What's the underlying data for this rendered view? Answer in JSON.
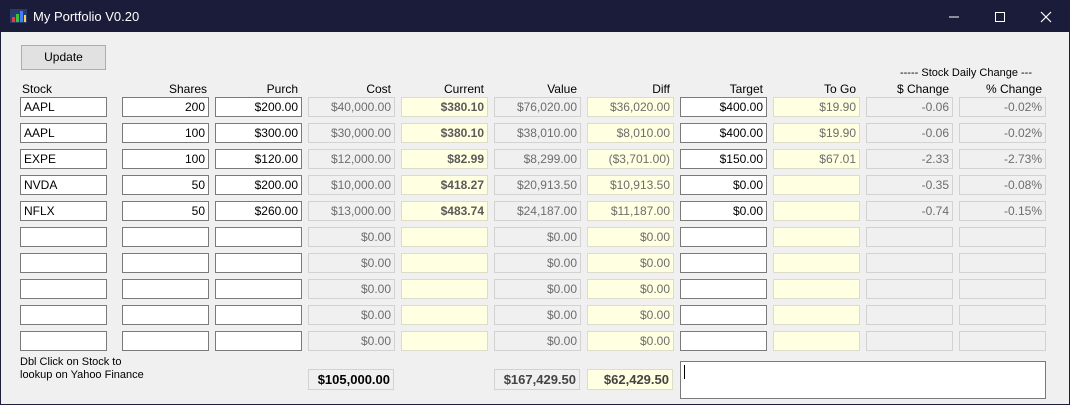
{
  "window": {
    "title": "My Portfolio V0.20",
    "icon": "chart-app-icon"
  },
  "toolbar": {
    "update_label": "Update"
  },
  "headers": {
    "stock": "Stock",
    "shares": "Shares",
    "purch": "Purch",
    "cost": "Cost",
    "current": "Current",
    "value": "Value",
    "diff": "Diff",
    "target": "Target",
    "to_go": "To Go",
    "daily_group": "----- Stock  Daily Change ---",
    "dollar_change": "$ Change",
    "pct_change": "% Change"
  },
  "rows": [
    {
      "stock": "AAPL",
      "shares": "200",
      "purch": "$200.00",
      "cost": "$40,000.00",
      "current": "$380.10",
      "value": "$76,020.00",
      "diff": "$36,020.00",
      "target": "$400.00",
      "to_go": "$19.90",
      "dchg": "-0.06",
      "pchg": "-0.02%"
    },
    {
      "stock": "AAPL",
      "shares": "100",
      "purch": "$300.00",
      "cost": "$30,000.00",
      "current": "$380.10",
      "value": "$38,010.00",
      "diff": "$8,010.00",
      "target": "$400.00",
      "to_go": "$19.90",
      "dchg": "-0.06",
      "pchg": "-0.02%"
    },
    {
      "stock": "EXPE",
      "shares": "100",
      "purch": "$120.00",
      "cost": "$12,000.00",
      "current": "$82.99",
      "value": "$8,299.00",
      "diff": "($3,701.00)",
      "target": "$150.00",
      "to_go": "$67.01",
      "dchg": "-2.33",
      "pchg": "-2.73%"
    },
    {
      "stock": "NVDA",
      "shares": "50",
      "purch": "$200.00",
      "cost": "$10,000.00",
      "current": "$418.27",
      "value": "$20,913.50",
      "diff": "$10,913.50",
      "target": "$0.00",
      "to_go": "",
      "dchg": "-0.35",
      "pchg": "-0.08%"
    },
    {
      "stock": "NFLX",
      "shares": "50",
      "purch": "$260.00",
      "cost": "$13,000.00",
      "current": "$483.74",
      "value": "$24,187.00",
      "diff": "$11,187.00",
      "target": "$0.00",
      "to_go": "",
      "dchg": "-0.74",
      "pchg": "-0.15%"
    },
    {
      "stock": "",
      "shares": "",
      "purch": "",
      "cost": "$0.00",
      "current": "",
      "value": "$0.00",
      "diff": "$0.00",
      "target": "",
      "to_go": "",
      "dchg": "",
      "pchg": ""
    },
    {
      "stock": "",
      "shares": "",
      "purch": "",
      "cost": "$0.00",
      "current": "",
      "value": "$0.00",
      "diff": "$0.00",
      "target": "",
      "to_go": "",
      "dchg": "",
      "pchg": ""
    },
    {
      "stock": "",
      "shares": "",
      "purch": "",
      "cost": "$0.00",
      "current": "",
      "value": "$0.00",
      "diff": "$0.00",
      "target": "",
      "to_go": "",
      "dchg": "",
      "pchg": ""
    },
    {
      "stock": "",
      "shares": "",
      "purch": "",
      "cost": "$0.00",
      "current": "",
      "value": "$0.00",
      "diff": "$0.00",
      "target": "",
      "to_go": "",
      "dchg": "",
      "pchg": ""
    },
    {
      "stock": "",
      "shares": "",
      "purch": "",
      "cost": "$0.00",
      "current": "",
      "value": "$0.00",
      "diff": "$0.00",
      "target": "",
      "to_go": "",
      "dchg": "",
      "pchg": ""
    }
  ],
  "footer": {
    "note_line1": "Dbl Click on Stock to",
    "note_line2": "lookup on Yahoo Finance",
    "total_cost": "$105,000.00",
    "total_value": "$167,429.50",
    "total_diff": "$62,429.50",
    "notes_text": ""
  },
  "colors": {
    "titlebar": "#1b1b3a",
    "window_bg": "#f0f0f0",
    "readonly_yellow": "#ffffe1"
  }
}
